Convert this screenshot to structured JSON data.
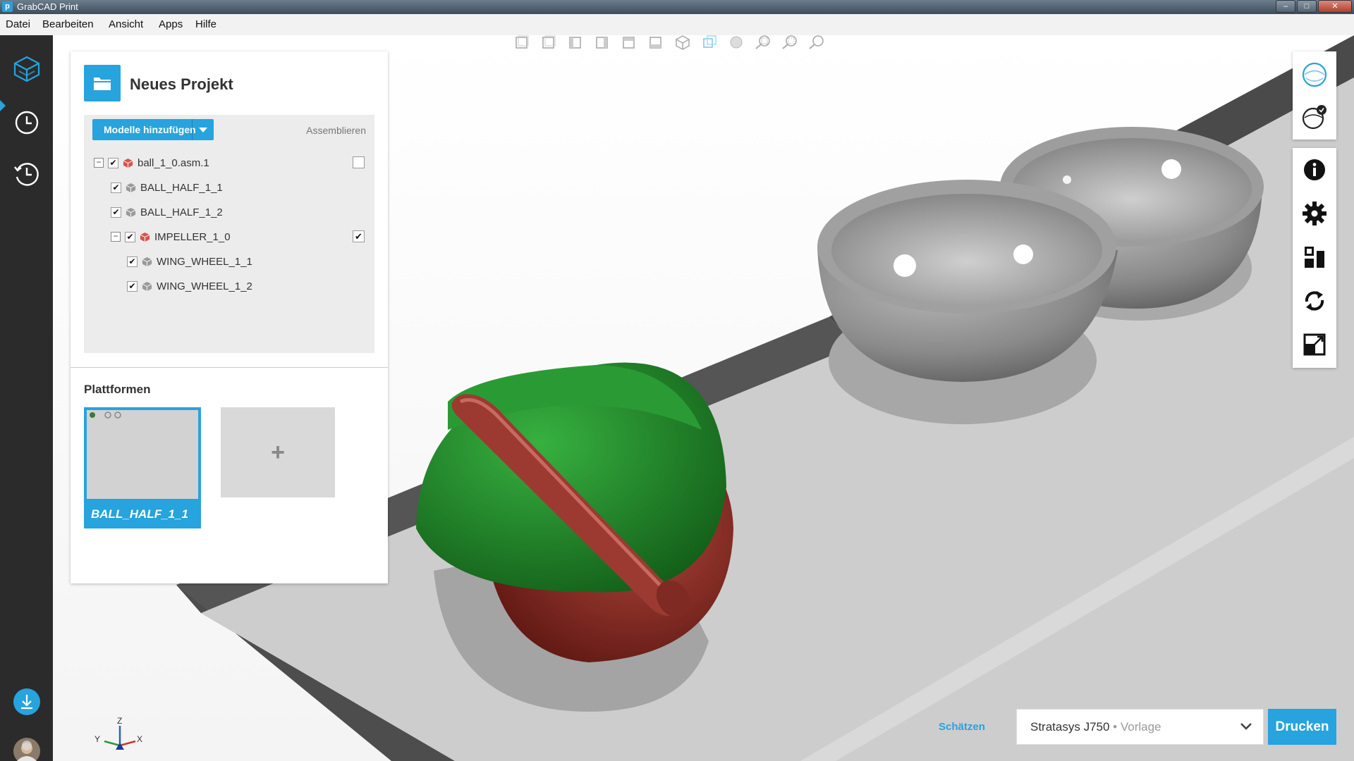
{
  "window": {
    "title": "GrabCAD Print",
    "app_icon_letter": "p"
  },
  "menu": [
    "Datei",
    "Bearbeiten",
    "Ansicht",
    "Apps",
    "Hilfe"
  ],
  "left_rail": [
    "cube-icon",
    "clock-icon",
    "history-icon",
    "download-icon",
    "avatar"
  ],
  "project": {
    "title": "Neues Projekt",
    "add_models_label": "Modelle hinzufügen",
    "assemble_label": "Assemblieren",
    "tree": [
      {
        "label": "ball_1_0.asm.1",
        "checked": true
      },
      {
        "label": "BALL_HALF_1_1",
        "checked": true
      },
      {
        "label": "BALL_HALF_1_2",
        "checked": true
      },
      {
        "label": "IMPELLER_1_0",
        "checked": true
      },
      {
        "label": "WING_WHEEL_1_1",
        "checked": true
      },
      {
        "label": "WING_WHEEL_1_2",
        "checked": true
      }
    ],
    "check_mark": "✔",
    "expander_minus": "−"
  },
  "platforms": {
    "title": "Plattformen",
    "cards": [
      {
        "label": "BALL_HALF_1_1"
      }
    ],
    "add_label": "+"
  },
  "bottom": {
    "estimate_label": "Schätzen",
    "printer_name": "Stratasys J750",
    "printer_separator": " • ",
    "printer_template": "Vorlage",
    "print_label": "Drucken"
  },
  "axes": {
    "x": "X",
    "y": "Y",
    "z": "Z"
  },
  "colors": {
    "accent": "#27a3dd",
    "rail": "#2b2b2b",
    "wing_green": "#1f8a2a",
    "impeller_red": "#8e2a24",
    "ball_gray": "#8c8c8c"
  }
}
